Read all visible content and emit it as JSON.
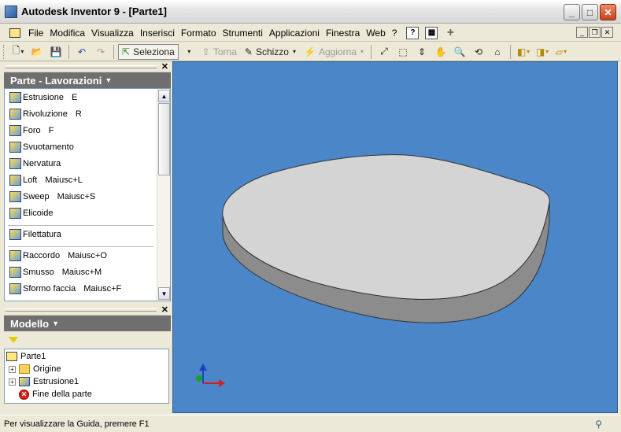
{
  "window": {
    "title": "Autodesk Inventor 9  - [Parte1]"
  },
  "menubar": {
    "items": [
      "File",
      "Modifica",
      "Visualizza",
      "Inserisci",
      "Formato",
      "Strumenti",
      "Applicazioni",
      "Finestra",
      "Web",
      "?"
    ]
  },
  "toolbar": {
    "select_label": "Seleziona",
    "return_label": "Torna",
    "sketch_label": "Schizzo",
    "update_label": "Aggiorna"
  },
  "feature_panel": {
    "title": "Parte - Lavorazioni",
    "commands_group1": [
      {
        "label": "Estrusione",
        "shortcut": "E"
      },
      {
        "label": "Rivoluzione",
        "shortcut": "R"
      },
      {
        "label": "Foro",
        "shortcut": "F"
      },
      {
        "label": "Svuotamento",
        "shortcut": ""
      },
      {
        "label": "Nervatura",
        "shortcut": ""
      },
      {
        "label": "Loft",
        "shortcut": "Maiusc+L"
      },
      {
        "label": "Sweep",
        "shortcut": "Maiusc+S"
      },
      {
        "label": "Elicoide",
        "shortcut": ""
      }
    ],
    "commands_group2": [
      {
        "label": "Filettatura",
        "shortcut": ""
      }
    ],
    "commands_group3": [
      {
        "label": "Raccordo",
        "shortcut": "Maiusc+O"
      },
      {
        "label": "Smusso",
        "shortcut": "Maiusc+M"
      },
      {
        "label": "Sformo faccia",
        "shortcut": "Maiusc+F"
      }
    ]
  },
  "model_panel": {
    "title": "Modello",
    "tree": {
      "root": "Parte1",
      "children": [
        "Origine",
        "Estrusione1",
        "Fine della parte"
      ]
    }
  },
  "status": {
    "text": "Per visualizzare la Guida, premere F1"
  },
  "colors": {
    "viewport_bg": "#4a86c8",
    "part_top": "#d4d4d4",
    "part_side": "#8c8c8c"
  }
}
